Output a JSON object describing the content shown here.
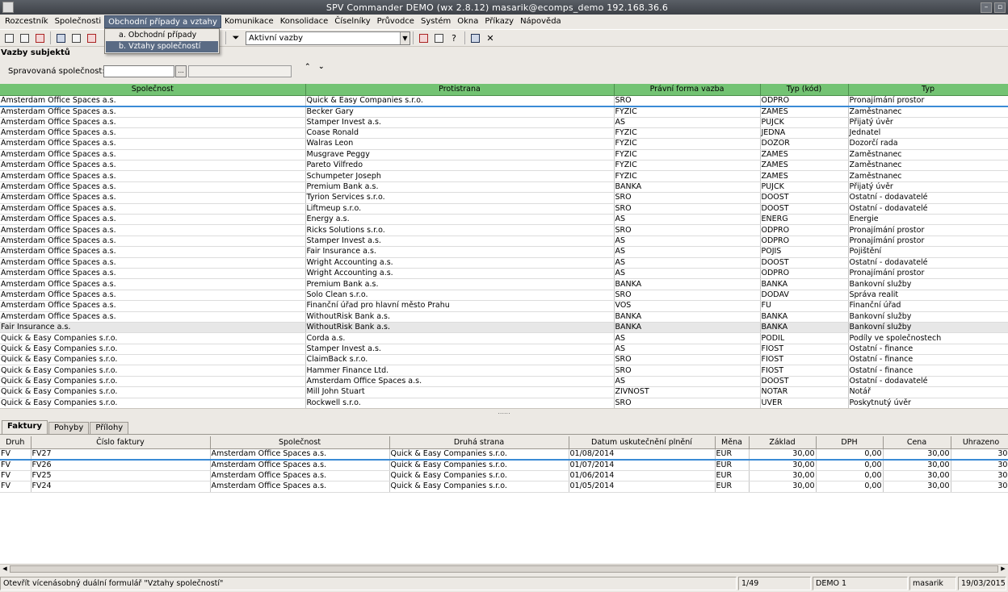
{
  "window": {
    "title": "SPV Commander DEMO (wx 2.8.12) masarik@ecomps_demo 192.168.36.6"
  },
  "menu": [
    "Rozcestník",
    "Společnosti",
    "Obchodní případy a vztahy",
    "Komunikace",
    "Konsolidace",
    "Číselníky",
    "Průvodce",
    "Systém",
    "Okna",
    "Příkazy",
    "Nápověda"
  ],
  "dropdown": {
    "items": [
      "a. Obchodní případy",
      "b. Vztahy společností"
    ]
  },
  "toolbar": {
    "fx_label": "f∞",
    "combo_value": "Aktivní vazby"
  },
  "section": {
    "title": "Vazby subjektů"
  },
  "filter": {
    "label": "Spravovaná společnost:",
    "browse_label": "...",
    "collapse_up": "⌃",
    "collapse_down": "⌄"
  },
  "grid1": {
    "columns": [
      "Společnost",
      "Protistrana",
      "Právní forma vazba",
      "Typ (kód)",
      "Typ"
    ],
    "rows": [
      [
        "Amsterdam Office Spaces a.s.",
        "Quick & Easy Companies s.r.o.",
        "SRO",
        "ODPRO",
        "Pronajímání prostor"
      ],
      [
        "Amsterdam Office Spaces a.s.",
        "Becker Gary",
        "FYZIC",
        "ZAMES",
        "Zaměstnanec"
      ],
      [
        "Amsterdam Office Spaces a.s.",
        "Stamper Invest a.s.",
        "AS",
        "PUJCK",
        "Přijatý úvěr"
      ],
      [
        "Amsterdam Office Spaces a.s.",
        "Coase Ronald",
        "FYZIC",
        "JEDNA",
        "Jednatel"
      ],
      [
        "Amsterdam Office Spaces a.s.",
        "Walras Leon",
        "FYZIC",
        "DOZOR",
        "Dozorčí rada"
      ],
      [
        "Amsterdam Office Spaces a.s.",
        "Musgrave Peggy",
        "FYZIC",
        "ZAMES",
        "Zaměstnanec"
      ],
      [
        "Amsterdam Office Spaces a.s.",
        "Pareto Vilfredo",
        "FYZIC",
        "ZAMES",
        "Zaměstnanec"
      ],
      [
        "Amsterdam Office Spaces a.s.",
        "Schumpeter Joseph",
        "FYZIC",
        "ZAMES",
        "Zaměstnanec"
      ],
      [
        "Amsterdam Office Spaces a.s.",
        "Premium Bank a.s.",
        "BANKA",
        "PUJCK",
        "Přijatý úvěr"
      ],
      [
        "Amsterdam Office Spaces a.s.",
        "Tyrion Services s.r.o.",
        "SRO",
        "DOOST",
        "Ostatní - dodavatelé"
      ],
      [
        "Amsterdam Office Spaces a.s.",
        "Liftmeup s.r.o.",
        "SRO",
        "DOOST",
        "Ostatní - dodavatelé"
      ],
      [
        "Amsterdam Office Spaces a.s.",
        "Energy a.s.",
        "AS",
        "ENERG",
        "Energie"
      ],
      [
        "Amsterdam Office Spaces a.s.",
        "Ricks Solutions s.r.o.",
        "SRO",
        "ODPRO",
        "Pronajímání prostor"
      ],
      [
        "Amsterdam Office Spaces a.s.",
        "Stamper Invest a.s.",
        "AS",
        "ODPRO",
        "Pronajímání prostor"
      ],
      [
        "Amsterdam Office Spaces a.s.",
        "Fair Insurance a.s.",
        "AS",
        "POJIS",
        "Pojištění"
      ],
      [
        "Amsterdam Office Spaces a.s.",
        "Wright Accounting a.s.",
        "AS",
        "DOOST",
        "Ostatní - dodavatelé"
      ],
      [
        "Amsterdam Office Spaces a.s.",
        "Wright Accounting a.s.",
        "AS",
        "ODPRO",
        "Pronajímání prostor"
      ],
      [
        "Amsterdam Office Spaces a.s.",
        "Premium Bank a.s.",
        "BANKA",
        "BANKA",
        "Bankovní služby"
      ],
      [
        "Amsterdam Office Spaces a.s.",
        "Solo Clean s.r.o.",
        "SRO",
        "DODAV",
        "Správa realit"
      ],
      [
        "Amsterdam Office Spaces a.s.",
        "Finanční úřad pro hlavní město Prahu",
        "VOS",
        "FU",
        "Finanční úřad"
      ],
      [
        "Amsterdam Office Spaces a.s.",
        "WithoutRisk Bank a.s.",
        "BANKA",
        "BANKA",
        "Bankovní služby"
      ],
      [
        "Fair Insurance a.s.",
        "WithoutRisk Bank a.s.",
        "BANKA",
        "BANKA",
        "Bankovní služby"
      ],
      [
        "Quick & Easy Companies s.r.o.",
        "Corda a.s.",
        "AS",
        "PODIL",
        "Podíly ve společnostech"
      ],
      [
        "Quick & Easy Companies s.r.o.",
        "Stamper Invest a.s.",
        "AS",
        "FIOST",
        "Ostatní - finance"
      ],
      [
        "Quick & Easy Companies s.r.o.",
        "ClaimBack s.r.o.",
        "SRO",
        "FIOST",
        "Ostatní - finance"
      ],
      [
        "Quick & Easy Companies s.r.o.",
        "Hammer Finance Ltd.",
        "SRO",
        "FIOST",
        "Ostatní - finance"
      ],
      [
        "Quick & Easy Companies s.r.o.",
        "Amsterdam Office Spaces a.s.",
        "AS",
        "DOOST",
        "Ostatní - dodavatelé"
      ],
      [
        "Quick & Easy Companies s.r.o.",
        "Mill John Stuart",
        "ZIVNOST",
        "NOTAR",
        "Notář"
      ],
      [
        "Quick & Easy Companies s.r.o.",
        "Rockwell s.r.o.",
        "SRO",
        "UVER",
        "Poskytnutý úvěr"
      ]
    ]
  },
  "splitter_grip": "......",
  "tabs": [
    "Faktury",
    "Pohyby",
    "Přílohy"
  ],
  "grid2": {
    "columns": [
      "Druh",
      "Číslo faktury",
      "Společnost",
      "Druhá strana",
      "Datum uskutečnění plnění",
      "Měna",
      "Základ",
      "DPH",
      "Cena",
      "Uhrazeno"
    ],
    "rows": [
      [
        "FV",
        "FV27",
        "Amsterdam Office Spaces a.s.",
        "Quick & Easy Companies s.r.o.",
        "01/08/2014",
        "EUR",
        "30,00",
        "0,00",
        "30,00",
        "30,"
      ],
      [
        "FV",
        "FV26",
        "Amsterdam Office Spaces a.s.",
        "Quick & Easy Companies s.r.o.",
        "01/07/2014",
        "EUR",
        "30,00",
        "0,00",
        "30,00",
        "30,"
      ],
      [
        "FV",
        "FV25",
        "Amsterdam Office Spaces a.s.",
        "Quick & Easy Companies s.r.o.",
        "01/06/2014",
        "EUR",
        "30,00",
        "0,00",
        "30,00",
        "30,"
      ],
      [
        "FV",
        "FV24",
        "Amsterdam Office Spaces a.s.",
        "Quick & Easy Companies s.r.o.",
        "01/05/2014",
        "EUR",
        "30,00",
        "0,00",
        "30,00",
        "30,"
      ]
    ]
  },
  "status": {
    "message": "Otevřít vícenásobný duální formulář \"Vztahy společností\"",
    "record": "1/49",
    "db": "DEMO 1",
    "user": "masarik",
    "date": "19/03/2015"
  }
}
